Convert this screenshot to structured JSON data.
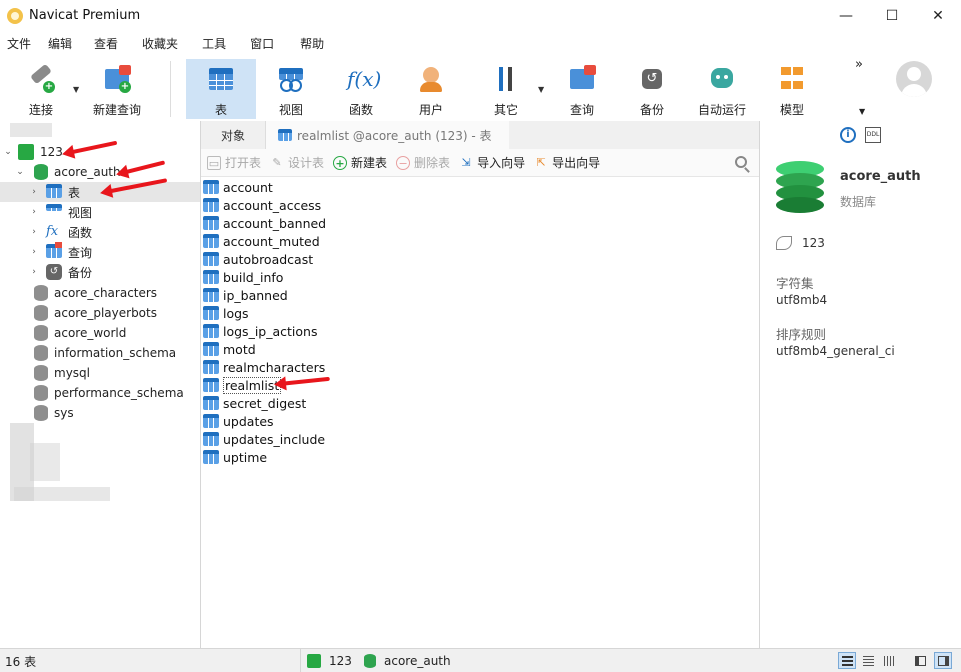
{
  "window": {
    "title": "Navicat Premium",
    "minimize": "—",
    "maximize": "☐",
    "close": "✕"
  },
  "menu": [
    "文件",
    "编辑",
    "查看",
    "收藏夹",
    "工具",
    "窗口",
    "帮助"
  ],
  "toolbar": {
    "connect": "连接",
    "new_query": "新建查询",
    "table": "表",
    "view": "视图",
    "function": "函数",
    "user": "用户",
    "other": "其它",
    "query": "查询",
    "backup": "备份",
    "automation": "自动运行",
    "model": "模型",
    "more": "»"
  },
  "tree": {
    "connection": "123",
    "database": "acore_auth",
    "children": [
      "表",
      "视图",
      "函数",
      "查询",
      "备份"
    ],
    "other_databases": [
      "acore_characters",
      "acore_playerbots",
      "acore_world",
      "information_schema",
      "mysql",
      "performance_schema",
      "sys"
    ]
  },
  "tabs": {
    "objects": "对象",
    "current": "realmlist @acore_auth (123) - 表"
  },
  "object_toolbar": {
    "open_table": "打开表",
    "design_table": "设计表",
    "new_table": "新建表",
    "delete_table": "删除表",
    "import_wizard": "导入向导",
    "export_wizard": "导出向导"
  },
  "tables": [
    "account",
    "account_access",
    "account_banned",
    "account_muted",
    "autobroadcast",
    "build_info",
    "ip_banned",
    "logs",
    "logs_ip_actions",
    "motd",
    "realmcharacters",
    "realmlist",
    "secret_digest",
    "updates",
    "updates_include",
    "uptime"
  ],
  "selected_table": "realmlist",
  "info": {
    "info_icon": "i",
    "ddl_icon": "DDL",
    "db_name": "acore_auth",
    "db_type": "数据库",
    "connection": "123",
    "charset_label": "字符集",
    "charset": "utf8mb4",
    "collation_label": "排序规则",
    "collation": "utf8mb4_general_ci"
  },
  "status": {
    "count": "16 表",
    "connection": "123",
    "database": "acore_auth"
  },
  "colors": {
    "accent": "#1f6fbf",
    "selection": "#cfe3f6",
    "annotation": "#e8161c",
    "db_green": "#2ea44f"
  }
}
